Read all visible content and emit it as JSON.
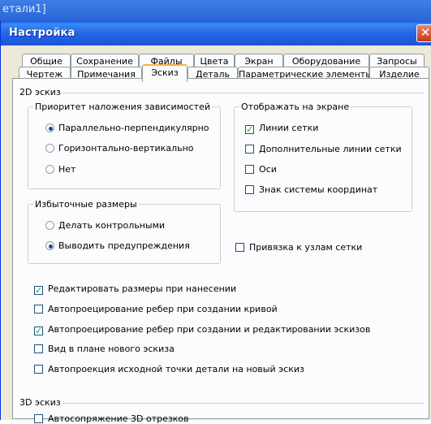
{
  "background": {
    "title_fragment": "етали1]"
  },
  "window": {
    "title": "Настройка"
  },
  "tabs_row1": [
    "Общие",
    "Сохранение",
    "Файлы",
    "Цвета",
    "Экран",
    "Оборудование",
    "Запросы"
  ],
  "tabs_row2": [
    "Чертеж",
    "Примечания",
    "Эскиз",
    "Деталь",
    "Параметрические элементы",
    "Изделие"
  ],
  "active_tab": "Эскиз",
  "sketch2d": {
    "section_label": "2D эскиз",
    "priority": {
      "legend": "Приоритет наложения зависимостей",
      "options": [
        {
          "label": "Параллельно-перпендикулярно",
          "selected": true
        },
        {
          "label": "Горизонтально-вертикально",
          "selected": false
        },
        {
          "label": "Нет",
          "selected": false
        }
      ]
    },
    "redundant": {
      "legend": "Избыточные размеры",
      "options": [
        {
          "label": "Делать контрольными",
          "selected": false
        },
        {
          "label": "Выводить предупреждения",
          "selected": true
        }
      ]
    },
    "display": {
      "legend": "Отображать на экране",
      "items": [
        {
          "label": "Линии сетки",
          "checked": true
        },
        {
          "label": "Дополнительные линии сетки",
          "checked": false
        },
        {
          "label": "Оси",
          "checked": false
        },
        {
          "label": "Знак системы координат",
          "checked": false
        }
      ]
    },
    "snap": {
      "label": "Привязка к узлам сетки",
      "checked": false
    },
    "options": [
      {
        "label": "Редактировать размеры при нанесении",
        "checked": true
      },
      {
        "label": "Автопроецирование ребер при создании кривой",
        "checked": false
      },
      {
        "label": "Автопроецирование ребер при создании и редактировании эскизов",
        "checked": true
      },
      {
        "label": "Вид в плане нового эскиза",
        "checked": false
      },
      {
        "label": "Автопроекция исходной точки детали на новый эскиз",
        "checked": false
      }
    ]
  },
  "sketch3d": {
    "section_label": "3D эскиз",
    "auto_fillet": {
      "label": "Автосопряжение 3D отрезков",
      "checked": false
    }
  },
  "colors": {
    "titlebar": "#2366e6",
    "dialog_bg": "#ece9d8",
    "active_tab_accent": "#f7b04a",
    "check_mark": "#21a121"
  }
}
